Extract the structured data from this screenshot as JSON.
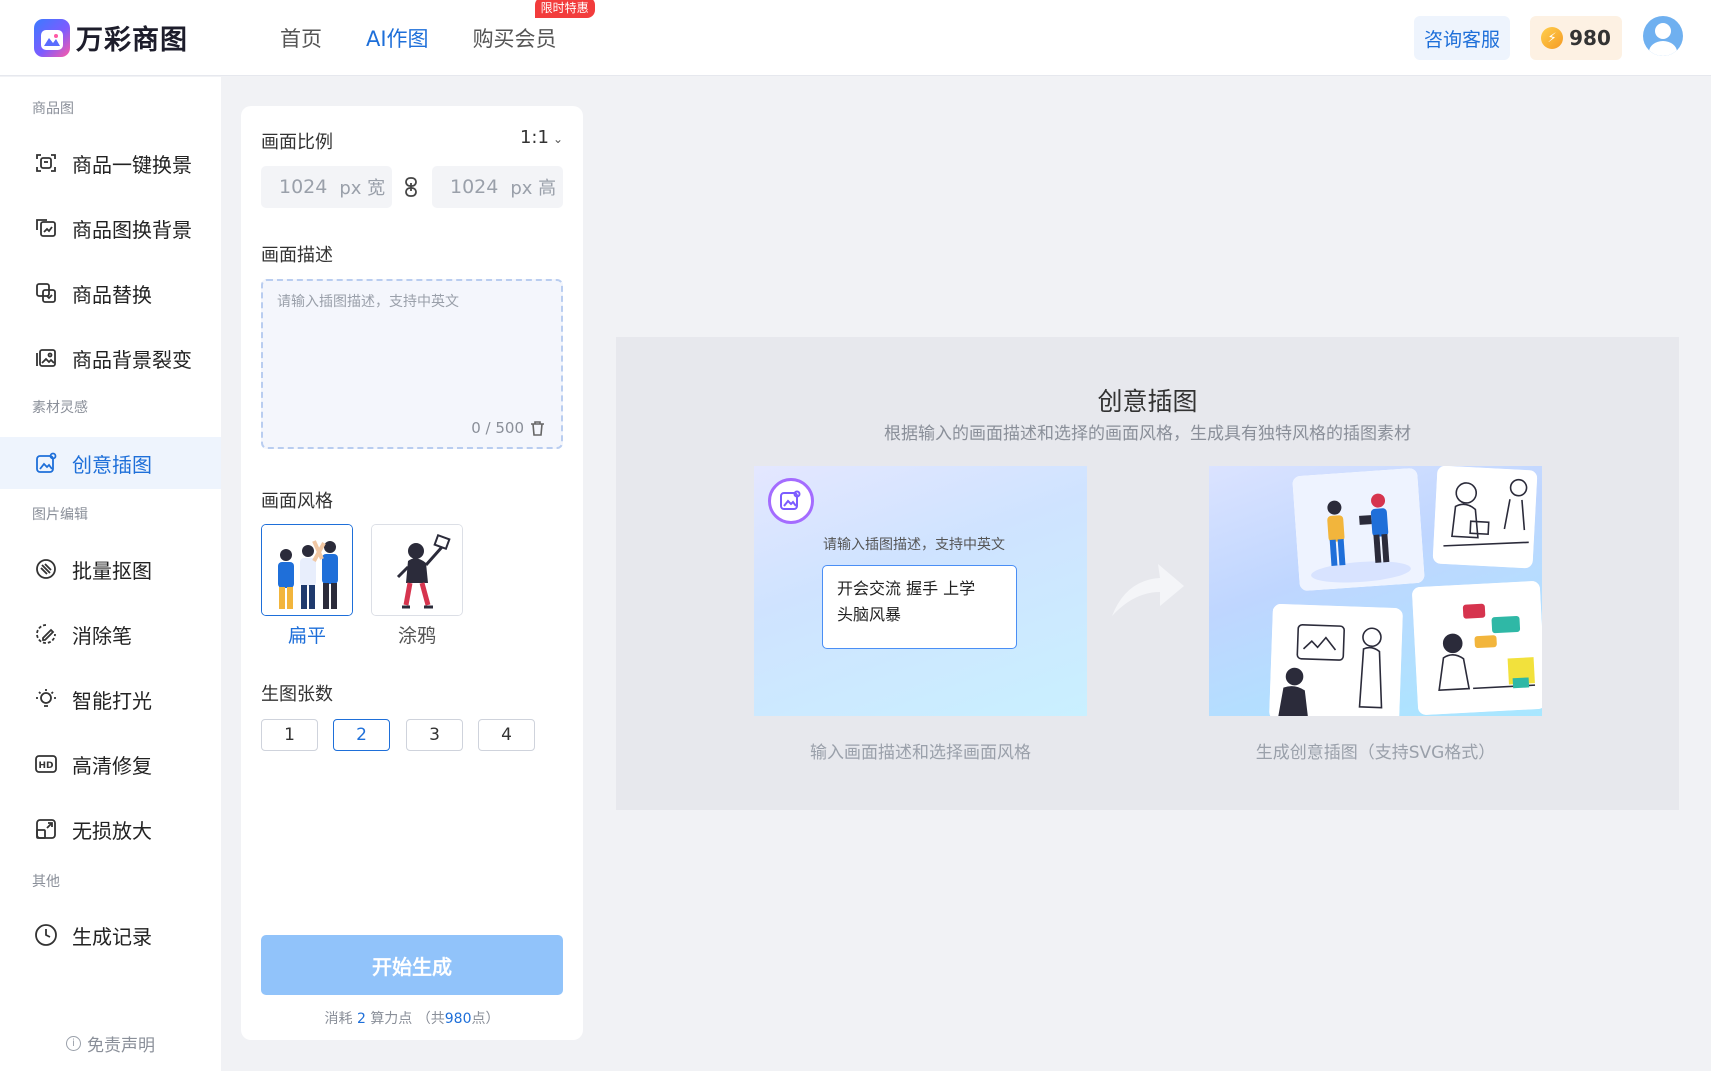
{
  "header": {
    "logo_text": "万彩商图",
    "nav": [
      {
        "label": "首页",
        "active": false
      },
      {
        "label": "AI作图",
        "active": true
      },
      {
        "label": "购买会员",
        "active": false,
        "badge": "限时特惠"
      }
    ],
    "consult_label": "咨询客服",
    "points": "980"
  },
  "sidebar": {
    "sections": [
      {
        "title": "商品图",
        "items": [
          {
            "label": "商品一键换景",
            "icon": "scan-frame-icon"
          },
          {
            "label": "商品图换背景",
            "icon": "image-swap-icon"
          },
          {
            "label": "商品替换",
            "icon": "replace-icon"
          },
          {
            "label": "商品背景裂变",
            "icon": "gallery-icon"
          }
        ]
      },
      {
        "title": "素材灵感",
        "items": [
          {
            "label": "创意插图",
            "icon": "creative-image-icon",
            "active": true
          }
        ]
      },
      {
        "title": "图片编辑",
        "items": [
          {
            "label": "批量抠图",
            "icon": "cutout-icon"
          },
          {
            "label": "消除笔",
            "icon": "eraser-icon"
          },
          {
            "label": "智能打光",
            "icon": "bulb-icon"
          },
          {
            "label": "高清修复",
            "icon": "hd-icon"
          },
          {
            "label": "无损放大",
            "icon": "enlarge-icon"
          }
        ]
      },
      {
        "title": "其他",
        "items": [
          {
            "label": "生成记录",
            "icon": "clock-icon"
          }
        ]
      }
    ],
    "disclaimer": "免责声明"
  },
  "panel": {
    "ratio_label": "画面比例",
    "ratio_value": "1:1",
    "width_value": "1024",
    "width_unit": "px 宽",
    "height_value": "1024",
    "height_unit": "px 高",
    "desc_label": "画面描述",
    "desc_placeholder": "请输入插图描述，支持中英文",
    "desc_count": "0 / 500",
    "style_label": "画面风格",
    "styles": [
      {
        "name": "扁平",
        "active": true
      },
      {
        "name": "涂鸦",
        "active": false
      }
    ],
    "count_label": "生图张数",
    "counts": [
      "1",
      "2",
      "3",
      "4"
    ],
    "count_selected": "2",
    "generate_label": "开始生成",
    "cost_prefix": "消耗",
    "cost_value": "2",
    "cost_mid": "算力点 （共",
    "cost_total": "980",
    "cost_suffix": "点）"
  },
  "showcase": {
    "title": "创意插图",
    "subtitle": "根据输入的画面描述和选择的画面风格，生成具有独特风格的插图素材",
    "demo_placeholder": "请输入插图描述，支持中英文",
    "demo_line1": "开会交流  握手  上学",
    "demo_line2": "头脑风暴",
    "left_caption": "输入画面描述和选择画面风格",
    "right_caption": "生成创意插图（支持SVG格式）"
  },
  "colors": {
    "accent": "#1e6fd9",
    "generate_button": "#91c3fa",
    "badge": "#f23c3c",
    "points_bg": "#fdf1e3"
  }
}
